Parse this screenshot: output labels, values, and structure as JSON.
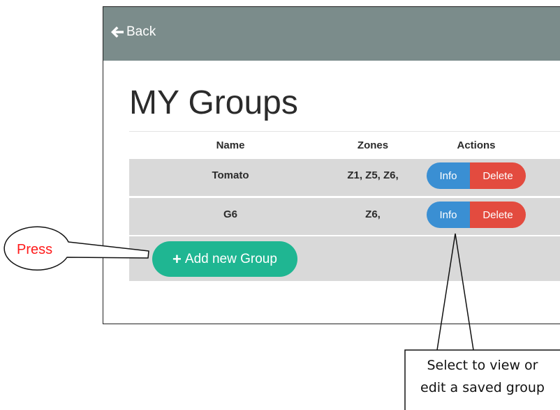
{
  "header": {
    "back_label": "Back"
  },
  "page": {
    "title": "MY Groups"
  },
  "table": {
    "columns": [
      "Name",
      "Zones",
      "Actions"
    ],
    "rows": [
      {
        "name": "Tomato",
        "zones": "Z1, Z5, Z6,",
        "info_label": "Info",
        "delete_label": "Delete"
      },
      {
        "name": "G6",
        "zones": "Z6,",
        "info_label": "Info",
        "delete_label": "Delete"
      }
    ]
  },
  "add_button": {
    "icon": "plus-icon",
    "label": "Add new Group"
  },
  "annotations": {
    "press": "Press",
    "callout_line1": "Select to view or",
    "callout_line2": "edit a saved group"
  },
  "colors": {
    "topbar": "#7b8c8b",
    "info": "#3a8fd3",
    "delete": "#e34b3f",
    "add": "#1fb692",
    "row_bg": "#d9d9d9",
    "annotation_red": "#ff1a1a"
  }
}
